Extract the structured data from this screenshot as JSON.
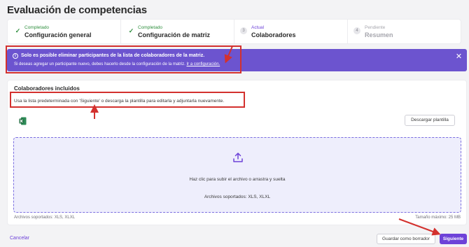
{
  "page": {
    "title": "Evaluación de competencias"
  },
  "stepper": {
    "steps": [
      {
        "status": "Completado",
        "name": "Configuración general",
        "icon": "check-icon"
      },
      {
        "status": "Completado",
        "name": "Configuración de matriz",
        "icon": "check-icon"
      },
      {
        "status": "Actual",
        "name": "Colaboradores",
        "number": "3"
      },
      {
        "status": "Pendiente",
        "name": "Resumen",
        "number": "4"
      }
    ]
  },
  "banner": {
    "line1": "Solo es posible eliminar participantes de la lista de colaboradores de la matriz.",
    "line2": "Si deseas agregar un participante nuevo, debes hacerlo desde la configuración de la matriz.",
    "link": "Ir a configuración.",
    "color": "#6c54cf"
  },
  "collaborators": {
    "title": "Colaboradores incluidos",
    "helper": "Usa la lista predeterminada con 'Siguiente' o descarga la plantilla para editarla y adjuntarla nuevamente.",
    "download_label": "Descargar plantilla",
    "dropzone_main": "Haz clic para subir el archivo o arrastra y suelta",
    "dropzone_formats": "Archivos soportados: XLS, XLXL",
    "footer_formats": "Archivos soportados: XLS, XLXL",
    "footer_max": "Tamaño máximo: 25 MB"
  },
  "actions": {
    "cancel": "Cancelar",
    "save_draft": "Guardar como borrador",
    "next": "Siguiente"
  },
  "colors": {
    "accent": "#6d42d8",
    "success": "#2f8f3e",
    "annotation": "#d3312e"
  }
}
